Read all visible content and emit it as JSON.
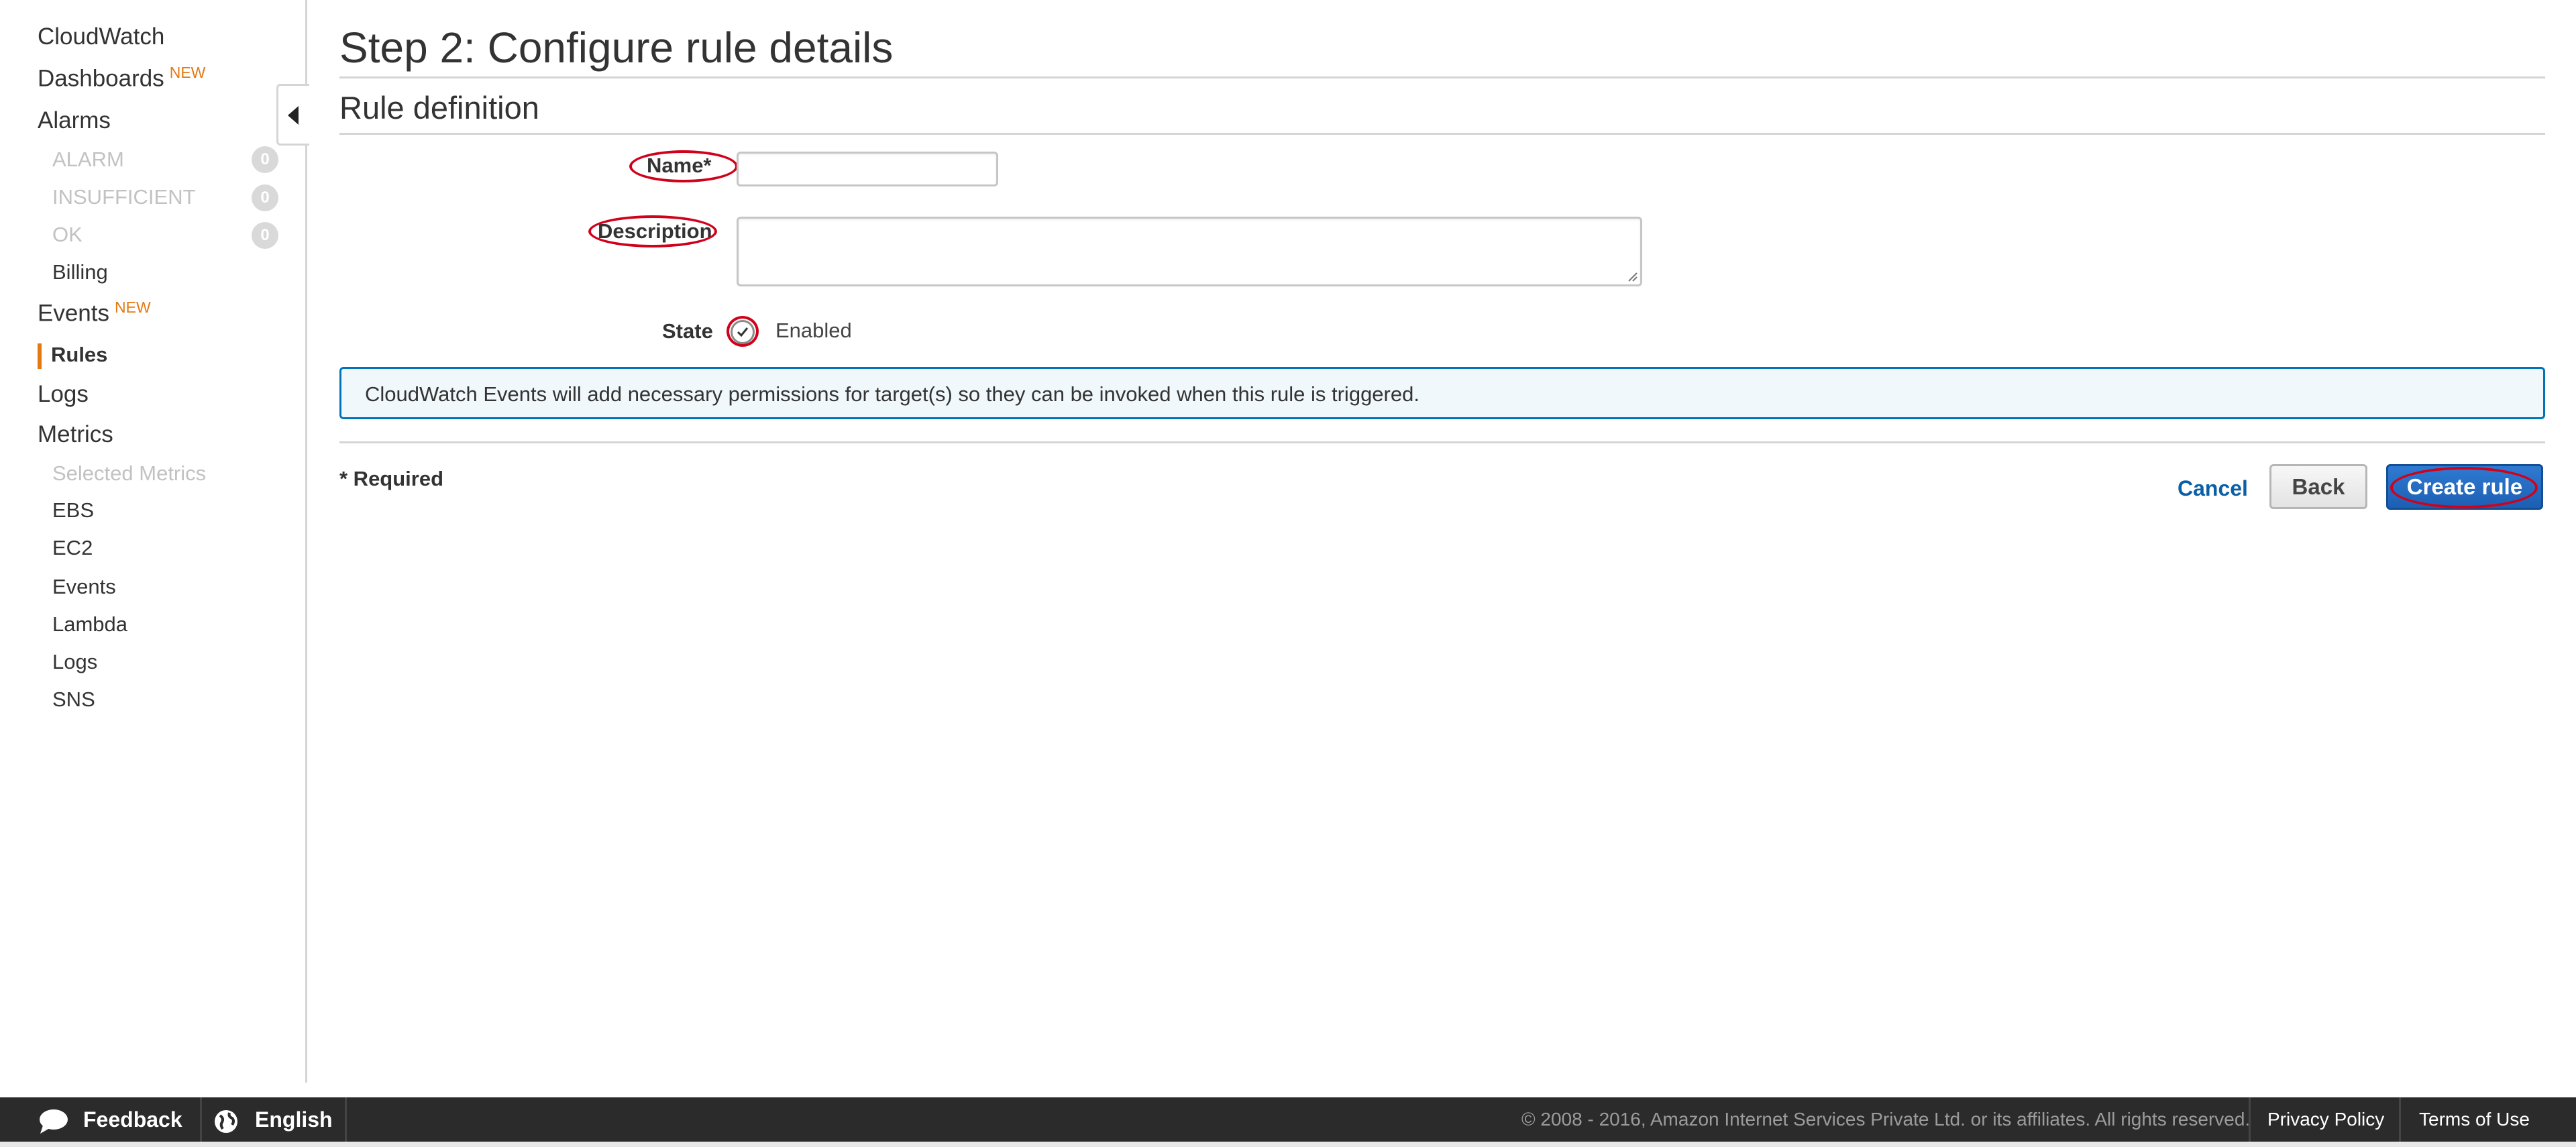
{
  "sidebar": {
    "title": "CloudWatch",
    "dashboards": {
      "label": "Dashboards",
      "badge": "NEW"
    },
    "alarms": {
      "label": "Alarms",
      "items": [
        {
          "label": "ALARM",
          "count": "0"
        },
        {
          "label": "INSUFFICIENT",
          "count": "0"
        },
        {
          "label": "OK",
          "count": "0"
        }
      ]
    },
    "billing": "Billing",
    "events": {
      "label": "Events",
      "badge": "NEW",
      "rules": "Rules"
    },
    "logs": "Logs",
    "metrics": {
      "label": "Metrics",
      "selected": "Selected Metrics",
      "items": [
        "EBS",
        "EC2",
        "Events",
        "Lambda",
        "Logs",
        "SNS"
      ]
    }
  },
  "main": {
    "title": "Step 2: Configure rule details",
    "section": "Rule definition",
    "form": {
      "name_label": "Name*",
      "name_value": "",
      "description_label": "Description",
      "description_value": "",
      "state_label": "State",
      "state_value": "Enabled"
    },
    "info": "CloudWatch Events will add necessary permissions for target(s) so they can be invoked when this rule is triggered.",
    "required_note": "* Required",
    "actions": {
      "cancel": "Cancel",
      "back": "Back",
      "create": "Create rule"
    }
  },
  "footer": {
    "feedback": "Feedback",
    "language": "English",
    "copyright": "© 2008 - 2016, Amazon Internet Services Private Ltd. or its affiliates. All rights reserved.",
    "privacy": "Privacy Policy",
    "terms": "Terms of Use"
  },
  "colors": {
    "accent_orange": "#e47911",
    "primary_blue": "#1c5fb4",
    "link_blue": "#0b5fa5",
    "annotation_red": "#d0021b",
    "footer_bg": "#2b2b2b"
  }
}
